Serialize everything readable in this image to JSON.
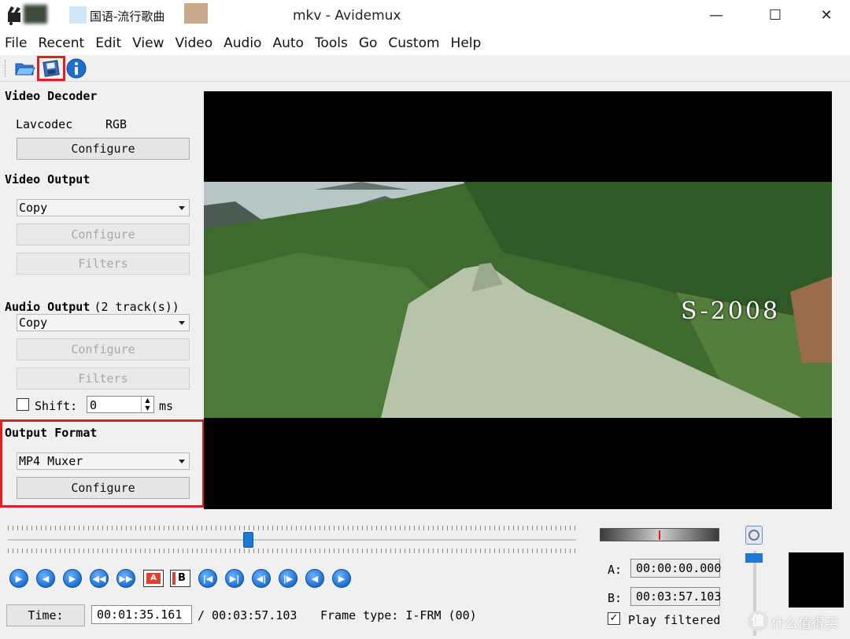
{
  "titlebar": {
    "tab_text": "国语-流行歌曲",
    "window_title": "mkv - Avidemux",
    "minimize_glyph": "—",
    "maximize_glyph": "☐",
    "close_glyph": "✕"
  },
  "menu": [
    "File",
    "Recent",
    "Edit",
    "View",
    "Video",
    "Audio",
    "Auto",
    "Tools",
    "Go",
    "Custom",
    "Help"
  ],
  "toolbar": {
    "icons": [
      "open-folder-icon",
      "save-icon",
      "info-icon"
    ]
  },
  "video_decoder": {
    "title": "Video Decoder",
    "codec": "Lavcodec",
    "format": "RGB",
    "configure_label": "Configure"
  },
  "video_output": {
    "title": "Video Output",
    "selected": "Copy",
    "configure_label": "Configure",
    "filters_label": "Filters"
  },
  "audio_output": {
    "title": "Audio Output",
    "tracks": "(2 track(s))",
    "selected": "Copy",
    "configure_label": "Configure",
    "filters_label": "Filters",
    "shift_label": "Shift:",
    "shift_value": "0",
    "shift_unit": "ms"
  },
  "output_format": {
    "title": "Output Format",
    "selected": "MP4 Muxer",
    "configure_label": "Configure"
  },
  "video_overlay_text": "S-2008",
  "timeline": {
    "position_fraction": 0.423
  },
  "marker_a": {
    "label": "A:",
    "value": "00:00:00.000"
  },
  "marker_b": {
    "label": "B:",
    "value": "00:03:57.103"
  },
  "play_filtered_label": "Play filtered",
  "status": {
    "time_button": "Time:",
    "current_time": "00:01:35.161",
    "total_time": "/ 00:03:57.103",
    "frame_type": "Frame type: I-FRM (00)"
  },
  "watermark": "什么值得买",
  "colors": {
    "highlight": "#e02020",
    "accent": "#1e78d8"
  }
}
